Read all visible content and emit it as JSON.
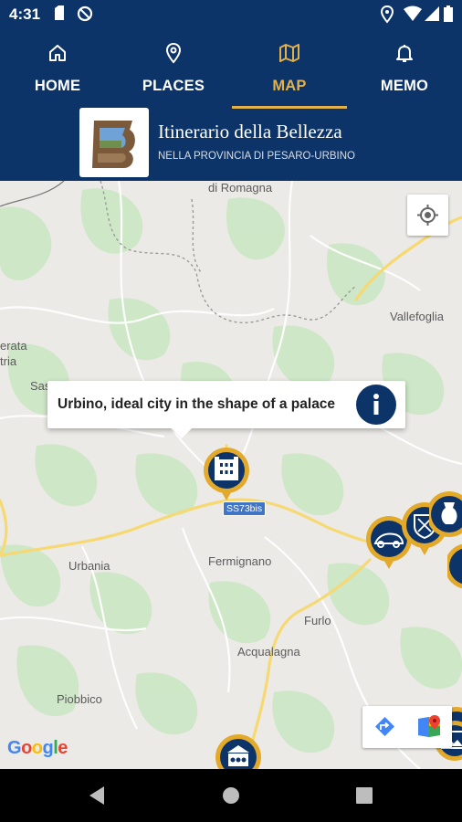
{
  "status_bar": {
    "time": "4:31"
  },
  "tabs": [
    {
      "label": "HOME",
      "icon": "home-icon",
      "active": false
    },
    {
      "label": "PLACES",
      "icon": "location-pin-icon",
      "active": false
    },
    {
      "label": "MAP",
      "icon": "map-icon",
      "active": true
    },
    {
      "label": "MEMO",
      "icon": "bell-icon",
      "active": false
    }
  ],
  "brand": {
    "title": "Itinerario della Bellezza",
    "subtitle": "NELLA PROVINCIA DI PESARO-URBINO"
  },
  "map": {
    "places": [
      "di Romagna",
      "Vallefoglia",
      "erata",
      "tria",
      "Sas",
      "Urbania",
      "Fermignano",
      "Furlo",
      "Acqualagna",
      "Piobbico"
    ],
    "road_shield": "SS73bis",
    "popup_text": "Urbino, ideal city in the shape of a palace",
    "attribution": "Google"
  },
  "colors": {
    "header_bg": "#0d3468",
    "accent": "#e3b14a",
    "marker_gold": "#e3a92b",
    "map_land": "#eceae6",
    "map_green": "#c8e6c3",
    "road_yellow": "#f6d972"
  }
}
